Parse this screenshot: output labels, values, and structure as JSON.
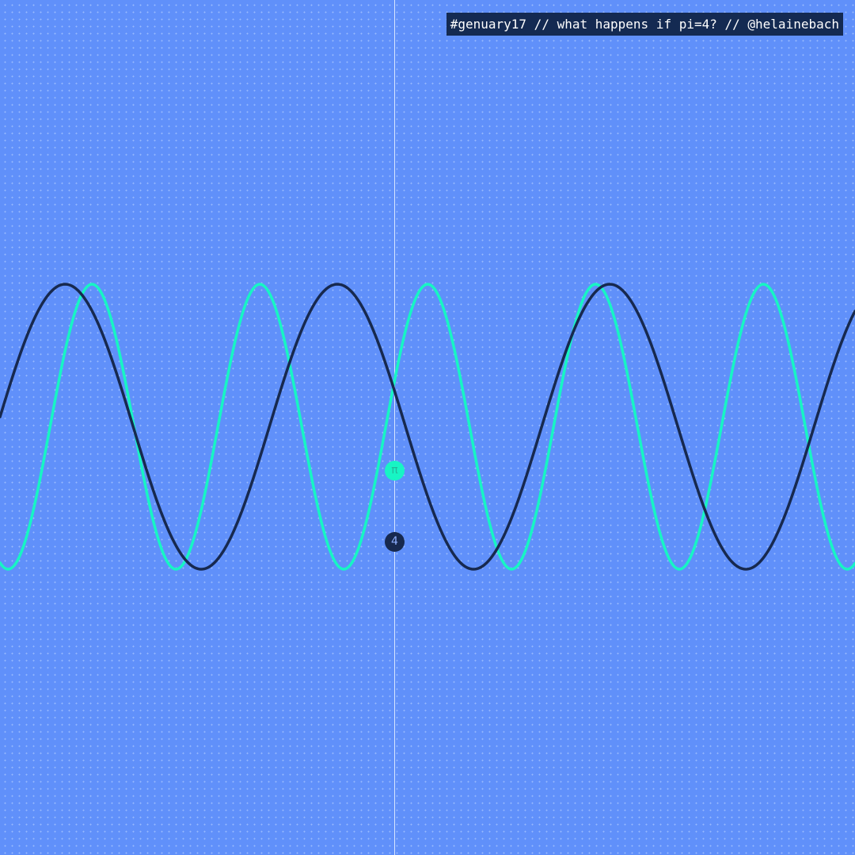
{
  "caption": "#genuary17 // what happens if pi=4? // @helainebach",
  "markers": {
    "pi_symbol": "π",
    "four_symbol": "4"
  },
  "colors": {
    "background": "#6090fa",
    "dots": "#c8dcff",
    "pi_wave": "#17f5c4",
    "four_wave": "#17294f",
    "center_line": "#d8e6ff"
  }
}
